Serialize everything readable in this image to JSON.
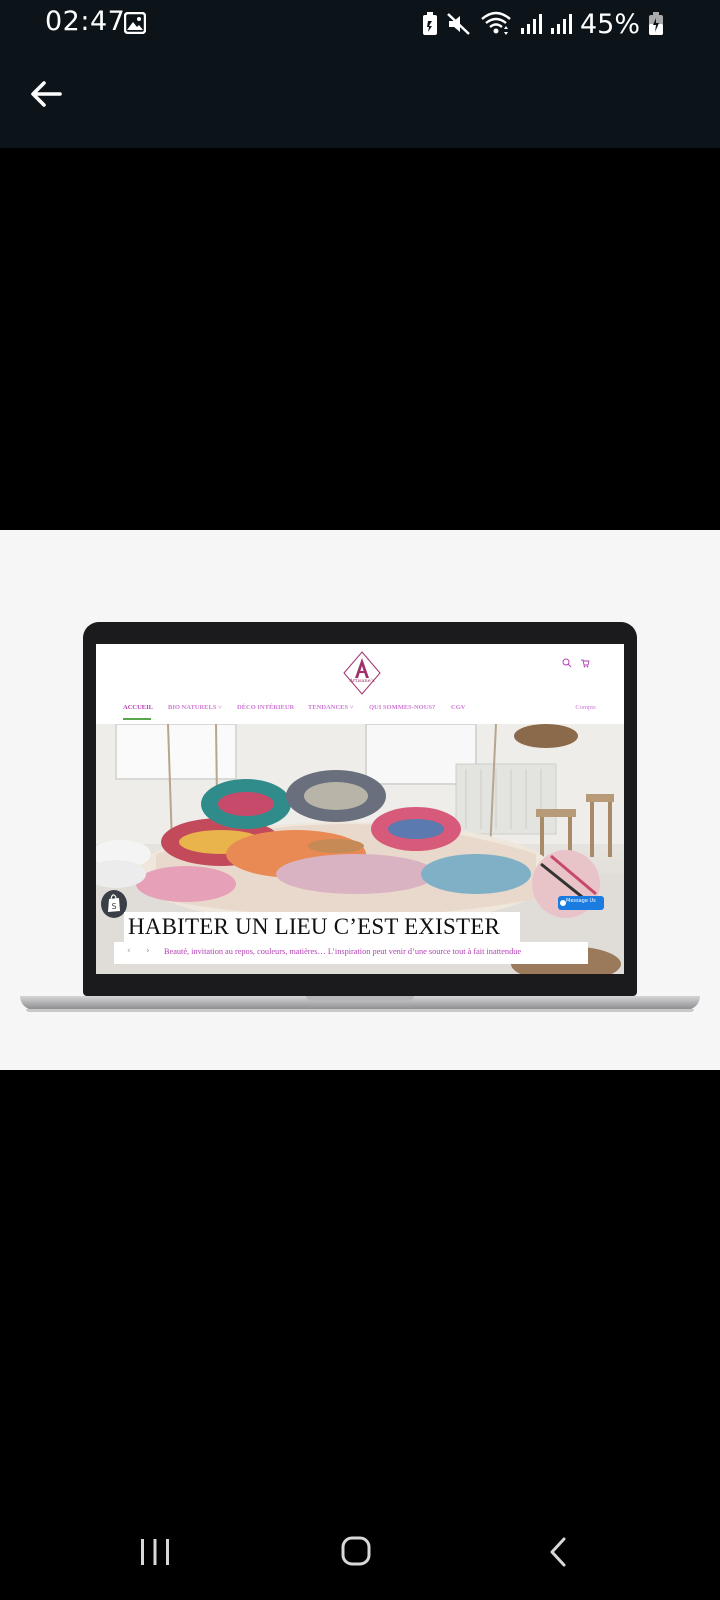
{
  "status_bar": {
    "time": "02:47",
    "battery_percent": "45%",
    "icons": [
      "gallery-icon",
      "battery-saver-icon",
      "mute-icon",
      "wifi-icon",
      "signal-icon",
      "signal-icon",
      "battery-charging-icon"
    ]
  },
  "app_bar": {
    "back_icon": "arrow-left-icon"
  },
  "website": {
    "logo_text": "Artisane's",
    "nav": {
      "items": [
        {
          "label": "ACCUEIL",
          "active": true
        },
        {
          "label": "BIO NATURELS ˅",
          "active": false
        },
        {
          "label": "DÉCO INTÉRIEUR",
          "active": false
        },
        {
          "label": "TENDANCES ˅",
          "active": false
        },
        {
          "label": "QUI SOMMES-NOUS?",
          "active": false
        },
        {
          "label": "CGV",
          "active": false
        }
      ],
      "account": "Compte"
    },
    "hero": {
      "title": "HABITER UN LIEU C’EST EXISTER",
      "subtitle": "Beauté, invitation au repos, couleurs, matières… L’inspiration peut venir d’une source tout à fait inattendue",
      "prev": "‹",
      "next": "›"
    },
    "message_button": "Message Us",
    "colors": {
      "accent": "#b33eb5",
      "nav_link": "#cf7ad6",
      "active_underline": "#57a84a",
      "logo": "#a0306a"
    }
  },
  "nav_bar": {
    "icons": [
      "recents-icon",
      "home-icon",
      "back-icon"
    ]
  }
}
